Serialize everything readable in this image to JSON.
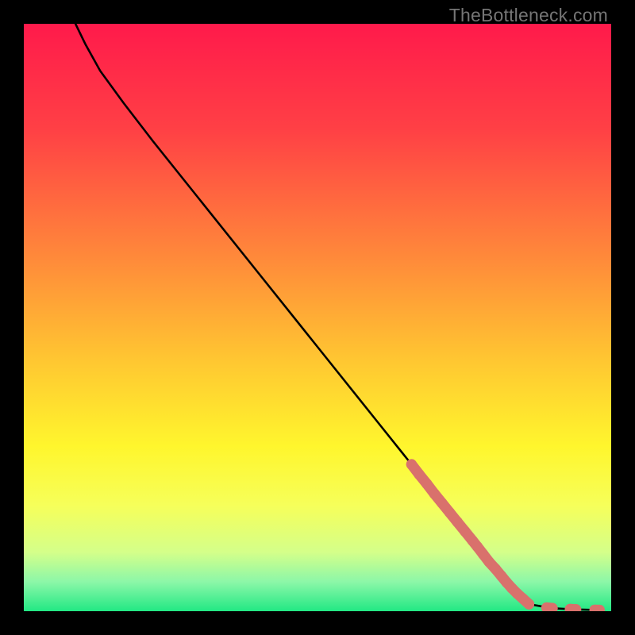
{
  "watermark": "TheBottleneck.com",
  "chart_data": {
    "type": "line",
    "title": "",
    "xlabel": "",
    "ylabel": "",
    "xlim": [
      0,
      100
    ],
    "ylim": [
      0,
      100
    ],
    "grid": false,
    "legend": false,
    "gradient_stops": [
      {
        "pct": 0,
        "color": "#ff1a4b"
      },
      {
        "pct": 18,
        "color": "#ff4045"
      },
      {
        "pct": 40,
        "color": "#ff8a3a"
      },
      {
        "pct": 58,
        "color": "#ffc931"
      },
      {
        "pct": 72,
        "color": "#fff62d"
      },
      {
        "pct": 82,
        "color": "#f6ff5a"
      },
      {
        "pct": 90,
        "color": "#d4ff8a"
      },
      {
        "pct": 95,
        "color": "#8cf7a8"
      },
      {
        "pct": 100,
        "color": "#22e884"
      }
    ],
    "series": [
      {
        "name": "bottleneck-curve",
        "stroke": "#000000",
        "points": [
          {
            "x": 8.8,
            "y": 100.0
          },
          {
            "x": 10.5,
            "y": 96.5
          },
          {
            "x": 13.0,
            "y": 92.0
          },
          {
            "x": 17.0,
            "y": 86.5
          },
          {
            "x": 22.0,
            "y": 80.0
          },
          {
            "x": 30.0,
            "y": 70.0
          },
          {
            "x": 40.0,
            "y": 57.5
          },
          {
            "x": 50.0,
            "y": 45.0
          },
          {
            "x": 60.0,
            "y": 32.5
          },
          {
            "x": 66.0,
            "y": 25.0
          },
          {
            "x": 72.0,
            "y": 17.5
          },
          {
            "x": 78.0,
            "y": 10.0
          },
          {
            "x": 83.0,
            "y": 4.0
          },
          {
            "x": 86.0,
            "y": 1.2
          },
          {
            "x": 90.0,
            "y": 0.5
          },
          {
            "x": 94.0,
            "y": 0.3
          },
          {
            "x": 98.0,
            "y": 0.2
          }
        ]
      },
      {
        "name": "highlighted-segments",
        "stroke": "#d9716c",
        "type": "scatter",
        "points": [
          {
            "x": 66.0,
            "y": 25.0
          },
          {
            "x": 67.3,
            "y": 23.3
          },
          {
            "x": 68.6,
            "y": 21.7
          },
          {
            "x": 69.9,
            "y": 20.0
          },
          {
            "x": 71.2,
            "y": 18.4
          },
          {
            "x": 72.5,
            "y": 16.8
          },
          {
            "x": 73.8,
            "y": 15.2
          },
          {
            "x": 75.1,
            "y": 13.6
          },
          {
            "x": 76.4,
            "y": 12.0
          },
          {
            "x": 77.2,
            "y": 11.0
          },
          {
            "x": 78.2,
            "y": 9.7
          },
          {
            "x": 79.2,
            "y": 8.4
          },
          {
            "x": 80.3,
            "y": 7.2
          },
          {
            "x": 81.3,
            "y": 6.0
          },
          {
            "x": 82.2,
            "y": 4.9
          },
          {
            "x": 83.1,
            "y": 3.9
          },
          {
            "x": 84.0,
            "y": 3.0
          },
          {
            "x": 85.0,
            "y": 2.1
          },
          {
            "x": 86.0,
            "y": 1.2
          },
          {
            "x": 89.0,
            "y": 0.6
          },
          {
            "x": 90.0,
            "y": 0.5
          },
          {
            "x": 93.0,
            "y": 0.35
          },
          {
            "x": 94.0,
            "y": 0.3
          },
          {
            "x": 97.2,
            "y": 0.22
          },
          {
            "x": 98.0,
            "y": 0.2
          }
        ]
      }
    ]
  }
}
